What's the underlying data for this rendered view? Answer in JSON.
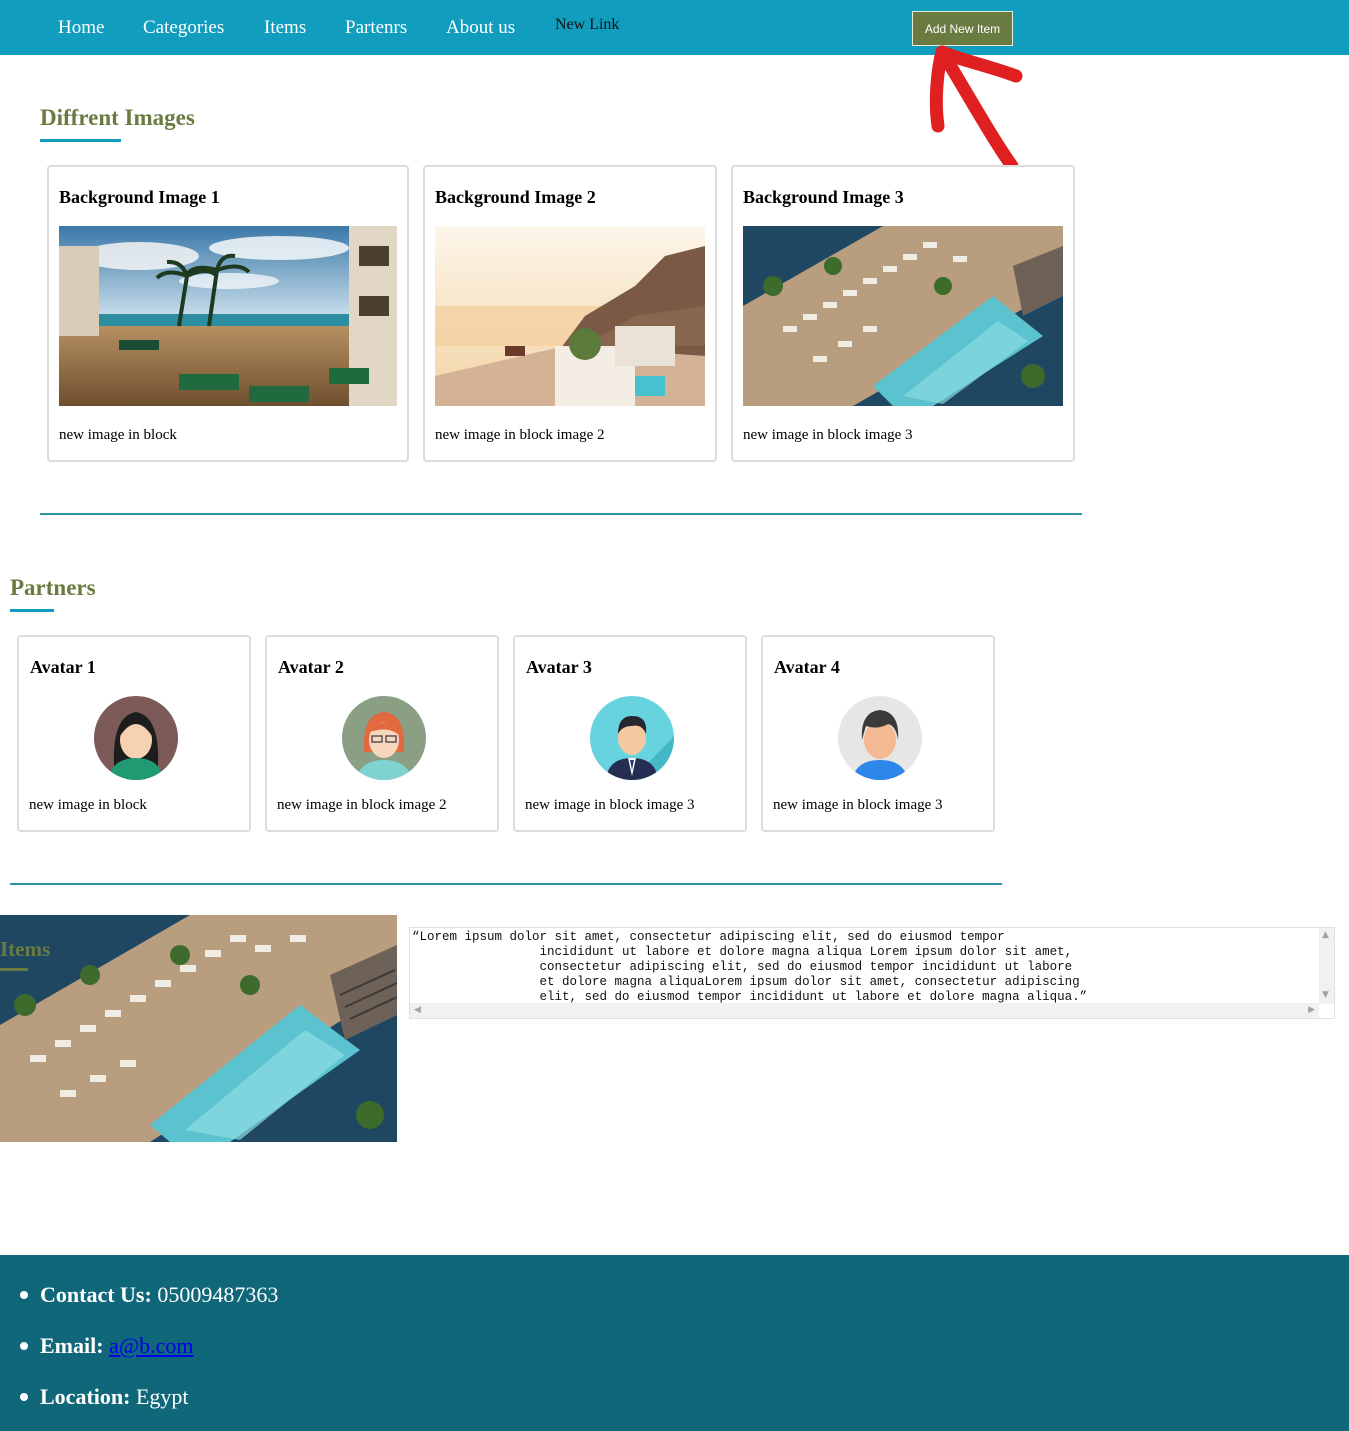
{
  "nav": {
    "links": [
      "Home",
      "Categories",
      "Items",
      "Partenrs",
      "About us",
      "New Link"
    ],
    "add_button": "Add New Item"
  },
  "images_section": {
    "title": "Diffrent Images",
    "cards": [
      {
        "title": "Background Image 1",
        "caption": "new image in block"
      },
      {
        "title": "Background Image 2",
        "caption": "new image in block image 2"
      },
      {
        "title": "Background Image 3",
        "caption": "new image in block image 3"
      }
    ]
  },
  "partners_section": {
    "title": "Partners",
    "cards": [
      {
        "title": "Avatar 1",
        "caption": "new image in block"
      },
      {
        "title": "Avatar 2",
        "caption": "new image in block image 2"
      },
      {
        "title": "Avatar 3",
        "caption": "new image in block image 3"
      },
      {
        "title": "Avatar 4",
        "caption": "new image in block image 3"
      }
    ]
  },
  "items_section": {
    "title": "Items",
    "text": "“Lorem ipsum dolor sit amet, consectetur adipiscing elit, sed do eiusmod tempor\n                 incididunt ut labore et dolore magna aliqua Lorem ipsum dolor sit amet,\n                 consectetur adipiscing elit, sed do eiusmod tempor incididunt ut labore\n                 et dolore magna aliquaLorem ipsum dolor sit amet, consectetur adipiscing\n                 elit, sed do eiusmod tempor incididunt ut labore et dolore magna aliqua.”"
  },
  "footer": {
    "contact_label": "Contact Us:",
    "contact_value": "05009487363",
    "email_label": "Email:",
    "email_value": "a@b.com",
    "location_label": "Location:",
    "location_value": "Egypt"
  },
  "colors": {
    "nav_bg": "#119dbe",
    "accent_olive": "#6a7b42",
    "footer_bg": "#11677a",
    "annotation_red": "#e02020"
  }
}
